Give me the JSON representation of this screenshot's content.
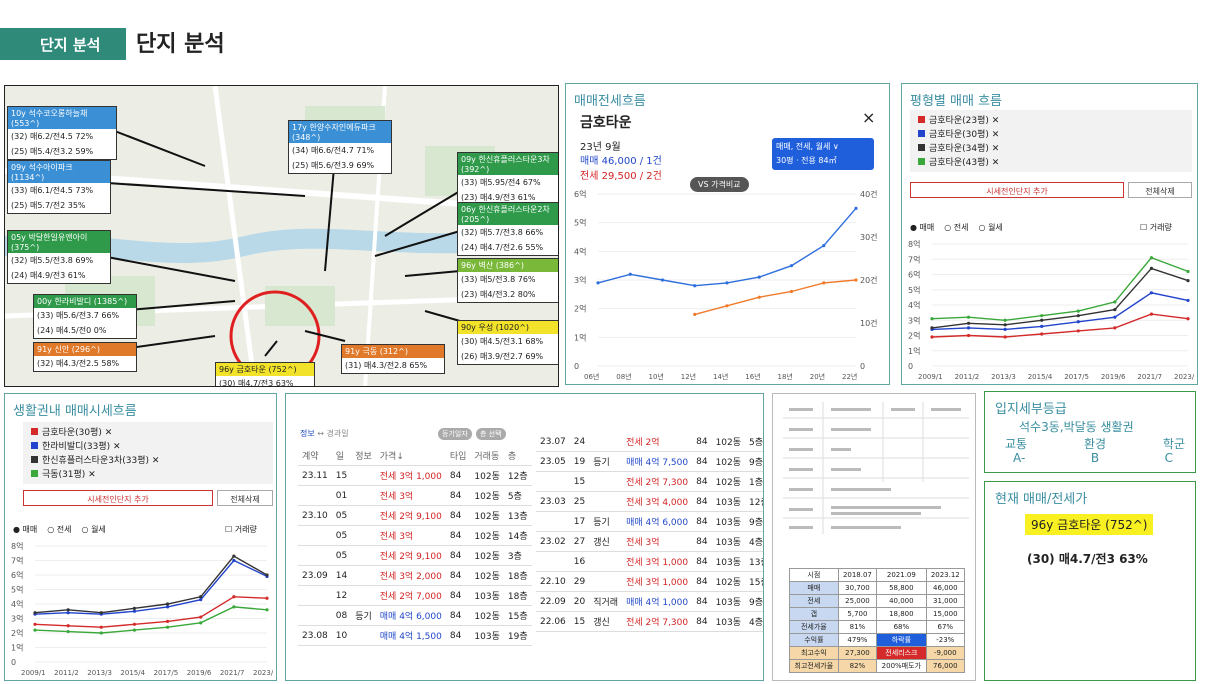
{
  "header": {
    "section_tag": "단지 분석",
    "title": "단지 분석"
  },
  "map": {
    "labels": [
      {
        "head": "10y 석수코오롱하늘채 (553^)",
        "rows": [
          "(32) 매6.2/전4.5 72%",
          "(25) 매5.4/전3.2 59%"
        ]
      },
      {
        "head": "09y 석수아이파크 (1134^)",
        "rows": [
          "(33) 매6.1/전4.5 73%",
          "(25) 매5.7/전2 35%"
        ]
      },
      {
        "head": "05y 박달한일유앤아이 (375^)",
        "rows": [
          "(32) 매5.5/전3.8 69%",
          "(24) 매4.9/전3 61%"
        ]
      },
      {
        "head": "00y 한라비발디 (1385^)",
        "rows": [
          "(33) 매5.6/전3.7 66%",
          "(24) 매4.5/전0 0%"
        ]
      },
      {
        "head": "91y 신안 (296^)",
        "rows": [
          "(32) 매4.3/전2.5 58%"
        ]
      },
      {
        "head": "17y 한양수자인에듀파크 (348^)",
        "rows": [
          "(34) 매6.6/전4.7 71%",
          "(25) 매5.6/전3.9 69%"
        ]
      },
      {
        "head": "09y 한신휴플러스타운3차 (392^)",
        "rows": [
          "(33) 매5.95/전4 67%",
          "(23) 매4.9/전3 61%"
        ]
      },
      {
        "head": "06y 한신휴플러스타운2차 (205^)",
        "rows": [
          "(32) 매5.7/전3.8 66%",
          "(24) 매4.7/전2.6 55%"
        ]
      },
      {
        "head": "96y 벽산 (386^)",
        "rows": [
          "(33) 매5/전3.8 76%",
          "(23) 매4/전3.2 80%"
        ]
      },
      {
        "head": "90y 우성 (1020^)",
        "rows": [
          "(30) 매4.5/전3.1 68%",
          "(26) 매3.9/전2.7 69%"
        ]
      },
      {
        "head": "91y 극동 (312^)",
        "rows": [
          "(31) 매4.3/전2.8 65%"
        ]
      },
      {
        "head": "96y 금호타운 (752^)",
        "rows": [
          "(30) 매4.7/전3 63%"
        ]
      }
    ]
  },
  "trade_flow": {
    "title": "매매전세흐름",
    "complex": "금호타운",
    "close": "×",
    "month": "23년 9월",
    "sale": "매매 46,000 / 1건",
    "jeonse": "전세 29,500 / 2건",
    "filter": "매매, 전세, 월세 ∨",
    "size": "30평 · 전용 84㎡",
    "compare": "VS 가격비교",
    "y_left": [
      "6억",
      "5억",
      "4억",
      "3억",
      "2억",
      "1억",
      "0"
    ],
    "y_right": [
      "40건",
      "30건",
      "20건",
      "10건",
      "0"
    ],
    "x": [
      "06년",
      "08년",
      "10년",
      "12년",
      "14년",
      "16년",
      "18년",
      "20년",
      "22년"
    ]
  },
  "chart_data": [
    {
      "type": "line",
      "title": "매매전세흐름",
      "x": [
        "06년",
        "08년",
        "10년",
        "12년",
        "14년",
        "16년",
        "18년",
        "20년",
        "22년"
      ],
      "series": [
        {
          "name": "매매",
          "values": [
            2.9,
            3.2,
            3.0,
            2.8,
            2.9,
            3.1,
            3.5,
            4.2,
            5.5
          ]
        },
        {
          "name": "전세",
          "values": [
            null,
            null,
            null,
            1.8,
            2.1,
            2.4,
            2.6,
            2.9,
            3.0
          ]
        }
      ],
      "ylim": [
        0,
        6
      ]
    },
    {
      "type": "line",
      "title": "평형별 매매 흐름",
      "x": [
        "2009/1",
        "2011/2",
        "2013/3",
        "2015/4",
        "2017/5",
        "2019/6",
        "2021/7",
        "2023/8"
      ],
      "series": [
        {
          "name": "금호타운(23평)",
          "values": [
            1.9,
            2.0,
            1.9,
            2.1,
            2.3,
            2.5,
            3.4,
            3.1
          ]
        },
        {
          "name": "금호타운(30평)",
          "values": [
            2.4,
            2.5,
            2.4,
            2.6,
            2.9,
            3.2,
            4.8,
            4.3
          ]
        },
        {
          "name": "금호타운(34평)",
          "values": [
            2.5,
            2.8,
            2.7,
            3.0,
            3.3,
            3.7,
            6.4,
            5.6
          ]
        },
        {
          "name": "금호타운(43평)",
          "values": [
            3.1,
            3.2,
            3.0,
            3.3,
            3.6,
            4.2,
            7.1,
            6.2
          ]
        }
      ],
      "ylim": [
        0,
        8
      ]
    },
    {
      "type": "line",
      "title": "생활권내 매매시세흐름",
      "x": [
        "2009/1",
        "2011/2",
        "2013/3",
        "2015/4",
        "2017/5",
        "2019/6",
        "2021/7",
        "2023/8"
      ],
      "series": [
        {
          "name": "금호타운(30평)",
          "values": [
            2.6,
            2.5,
            2.4,
            2.6,
            2.8,
            3.1,
            4.5,
            4.4
          ]
        },
        {
          "name": "한라비발디(33평)",
          "values": [
            3.3,
            3.4,
            3.3,
            3.5,
            3.8,
            4.3,
            7.0,
            5.9
          ]
        },
        {
          "name": "한신휴플러스타운3차(33평)",
          "values": [
            3.4,
            3.6,
            3.4,
            3.7,
            4.0,
            4.5,
            7.3,
            6.0
          ]
        },
        {
          "name": "극동(31평)",
          "values": [
            2.2,
            2.1,
            2.0,
            2.2,
            2.4,
            2.7,
            3.8,
            3.6
          ]
        }
      ],
      "ylim": [
        0,
        8
      ]
    }
  ],
  "size_flow": {
    "title": "평형별 매매 흐름",
    "legend": [
      "금호타운(23평)",
      "금호타운(30평)",
      "금호타운(34평)",
      "금호타운(43평)"
    ],
    "colors": [
      "#d42a2a",
      "#2244cc",
      "#333333",
      "#3aa83a"
    ],
    "add_btn": "시세전인단지 추가",
    "clear_btn": "전체삭제",
    "radios": [
      "매매",
      "전세",
      "월세"
    ],
    "volume": "거래량",
    "y": [
      "8억",
      "7억",
      "6억",
      "5억",
      "4억",
      "3억",
      "2억",
      "1억",
      "0"
    ],
    "x": [
      "2009/1",
      "2011/2",
      "2013/3",
      "2015/4",
      "2017/5",
      "2019/6",
      "2021/7",
      "2023/8"
    ]
  },
  "life_flow": {
    "title": "생활권내 매매시세흐름",
    "legend": [
      "금호타운(30평)",
      "한라비발디(33평)",
      "한신휴플러스타운3차(33평)",
      "극동(31평)"
    ],
    "colors": [
      "#d42a2a",
      "#2244cc",
      "#333333",
      "#3aa83a"
    ],
    "add_btn": "시세전인단지 추가",
    "clear_btn": "전체삭제",
    "radios": [
      "매매",
      "전세",
      "월세"
    ],
    "volume": "거래량",
    "y": [
      "8억",
      "7억",
      "6억",
      "5억",
      "4억",
      "3억",
      "2억",
      "1억",
      "0"
    ],
    "x": [
      "2009/1",
      "2011/2",
      "2013/3",
      "2015/4",
      "2017/5",
      "2019/6",
      "2021/7",
      "2023/8"
    ]
  },
  "deals": {
    "tab1": "정보",
    "tab2": "↔ 경과일",
    "btn1": "등기일자",
    "btn2": "층 선택",
    "headers": [
      "계약",
      "일",
      "정보",
      "가격↓",
      "타입",
      "거래동",
      "층"
    ],
    "left": [
      [
        "23.11",
        "15",
        "",
        "전세 3억 1,000",
        "84",
        "102동",
        "12층"
      ],
      [
        "",
        "01",
        "",
        "전세 3억",
        "84",
        "102동",
        "5층"
      ],
      [
        "23.10",
        "05",
        "",
        "전세 2억 9,100",
        "84",
        "102동",
        "13층"
      ],
      [
        "",
        "05",
        "",
        "전세 3억",
        "84",
        "102동",
        "14층"
      ],
      [
        "",
        "05",
        "",
        "전세 2억 9,100",
        "84",
        "102동",
        "3층"
      ],
      [
        "23.09",
        "14",
        "",
        "전세 3억 2,000",
        "84",
        "102동",
        "18층"
      ],
      [
        "",
        "12",
        "",
        "전세 2억 7,000",
        "84",
        "103동",
        "18층"
      ],
      [
        "",
        "08",
        "등기",
        "매매 4억 6,000",
        "84",
        "102동",
        "15층"
      ],
      [
        "23.08",
        "10",
        "",
        "매매 4억 1,500",
        "84",
        "103동",
        "19층"
      ]
    ],
    "right": [
      [
        "23.07",
        "24",
        "",
        "전세 2억",
        "84",
        "102동",
        "5층"
      ],
      [
        "23.05",
        "19",
        "등기",
        "매매 4억 7,500",
        "84",
        "102동",
        "9층"
      ],
      [
        "",
        "15",
        "",
        "전세 2억 7,300",
        "84",
        "102동",
        "1층"
      ],
      [
        "23.03",
        "25",
        "",
        "전세 3억 4,000",
        "84",
        "103동",
        "12층"
      ],
      [
        "",
        "17",
        "등기",
        "매매 4억 6,000",
        "84",
        "103동",
        "9층"
      ],
      [
        "23.02",
        "27",
        "갱신",
        "전세 3억",
        "84",
        "103동",
        "4층"
      ],
      [
        "",
        "16",
        "",
        "전세 3억 1,000",
        "84",
        "103동",
        "13층"
      ],
      [
        "22.10",
        "29",
        "",
        "전세 3억 1,000",
        "84",
        "102동",
        "15층"
      ],
      [
        "22.09",
        "20",
        "직거래",
        "매매 4억 1,000",
        "84",
        "103동",
        "9층"
      ],
      [
        "22.06",
        "15",
        "갱신",
        "전세 2억 7,300",
        "84",
        "103동",
        "4층"
      ]
    ]
  },
  "doc": {
    "summary_headers": [
      "시점",
      "2018.07",
      "2021.09",
      "2023.12"
    ],
    "summary_rows": [
      [
        "매매",
        "30,700",
        "58,800",
        "46,000"
      ],
      [
        "전세",
        "25,000",
        "40,000",
        "31,000"
      ],
      [
        "갭",
        "5,700",
        "18,800",
        "15,000"
      ],
      [
        "전세가율",
        "81%",
        "68%",
        "67%"
      ],
      [
        "수익률",
        "479%",
        "하락률",
        "-23%"
      ],
      [
        "최고수익",
        "27,300",
        "전세리스크",
        "-9,000"
      ],
      [
        "최고전세가율",
        "82%",
        "200%매도가",
        "76,000"
      ]
    ]
  },
  "grade": {
    "title": "입지세부등급",
    "area": "석수3동,박달동 생활권",
    "cols": [
      "교통",
      "환경",
      "학군"
    ],
    "grades": [
      "A-",
      "B",
      "C"
    ]
  },
  "current": {
    "title": "현재 매매/전세가",
    "name": "96y 금호타운 (752^)",
    "value": "(30) 매4.7/전3 63%"
  }
}
